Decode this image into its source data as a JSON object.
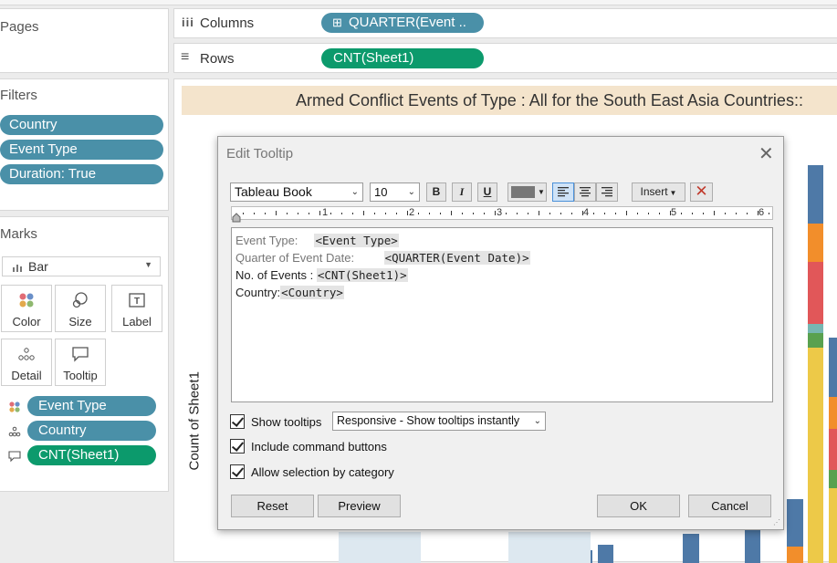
{
  "pages": {
    "title": "Pages"
  },
  "filters": {
    "title": "Filters",
    "items": [
      "Country",
      "Event Type",
      "Duration: True"
    ]
  },
  "marks": {
    "title": "Marks",
    "type": "Bar",
    "buttons": [
      "Color",
      "Size",
      "Label",
      "Detail",
      "Tooltip"
    ],
    "fields": [
      "Event Type",
      "Country",
      "CNT(Sheet1)"
    ]
  },
  "shelves": {
    "columns_label": "Columns",
    "columns_pill": "QUARTER(Event ..",
    "rows_label": "Rows",
    "rows_pill": "CNT(Sheet1)"
  },
  "sheet": {
    "title": "Armed Conflict Events of Type : All  for the South East Asia Countries::",
    "y_axis_label": "Count of Sheet1"
  },
  "dialog": {
    "title": "Edit Tooltip",
    "font": "Tableau Book",
    "size": "10",
    "bold": "B",
    "italic": "I",
    "underline": "U",
    "insert": "Insert",
    "ruler_marks": [
      "1",
      "2",
      "3",
      "4",
      "5",
      "6"
    ],
    "lines": [
      {
        "label": "Event Type:     ",
        "field": "<Event Type>"
      },
      {
        "label": "Quarter of Event Date:         ",
        "field": "<QUARTER(Event Date)>"
      },
      {
        "label": "No. of Events : ",
        "field": "<CNT(Sheet1)>"
      },
      {
        "label": "Country:",
        "field": "<Country>"
      }
    ],
    "show_tooltips": "Show tooltips",
    "tooltip_mode": "Responsive - Show tooltips instantly",
    "include_buttons": "Include command buttons",
    "allow_selection": "Allow selection by category",
    "reset": "Reset",
    "preview": "Preview",
    "ok": "OK",
    "cancel": "Cancel"
  },
  "colors": {
    "pill_blue": "#4a90a8",
    "pill_green": "#0c9a6c",
    "title_band": "#f4e4cc"
  }
}
